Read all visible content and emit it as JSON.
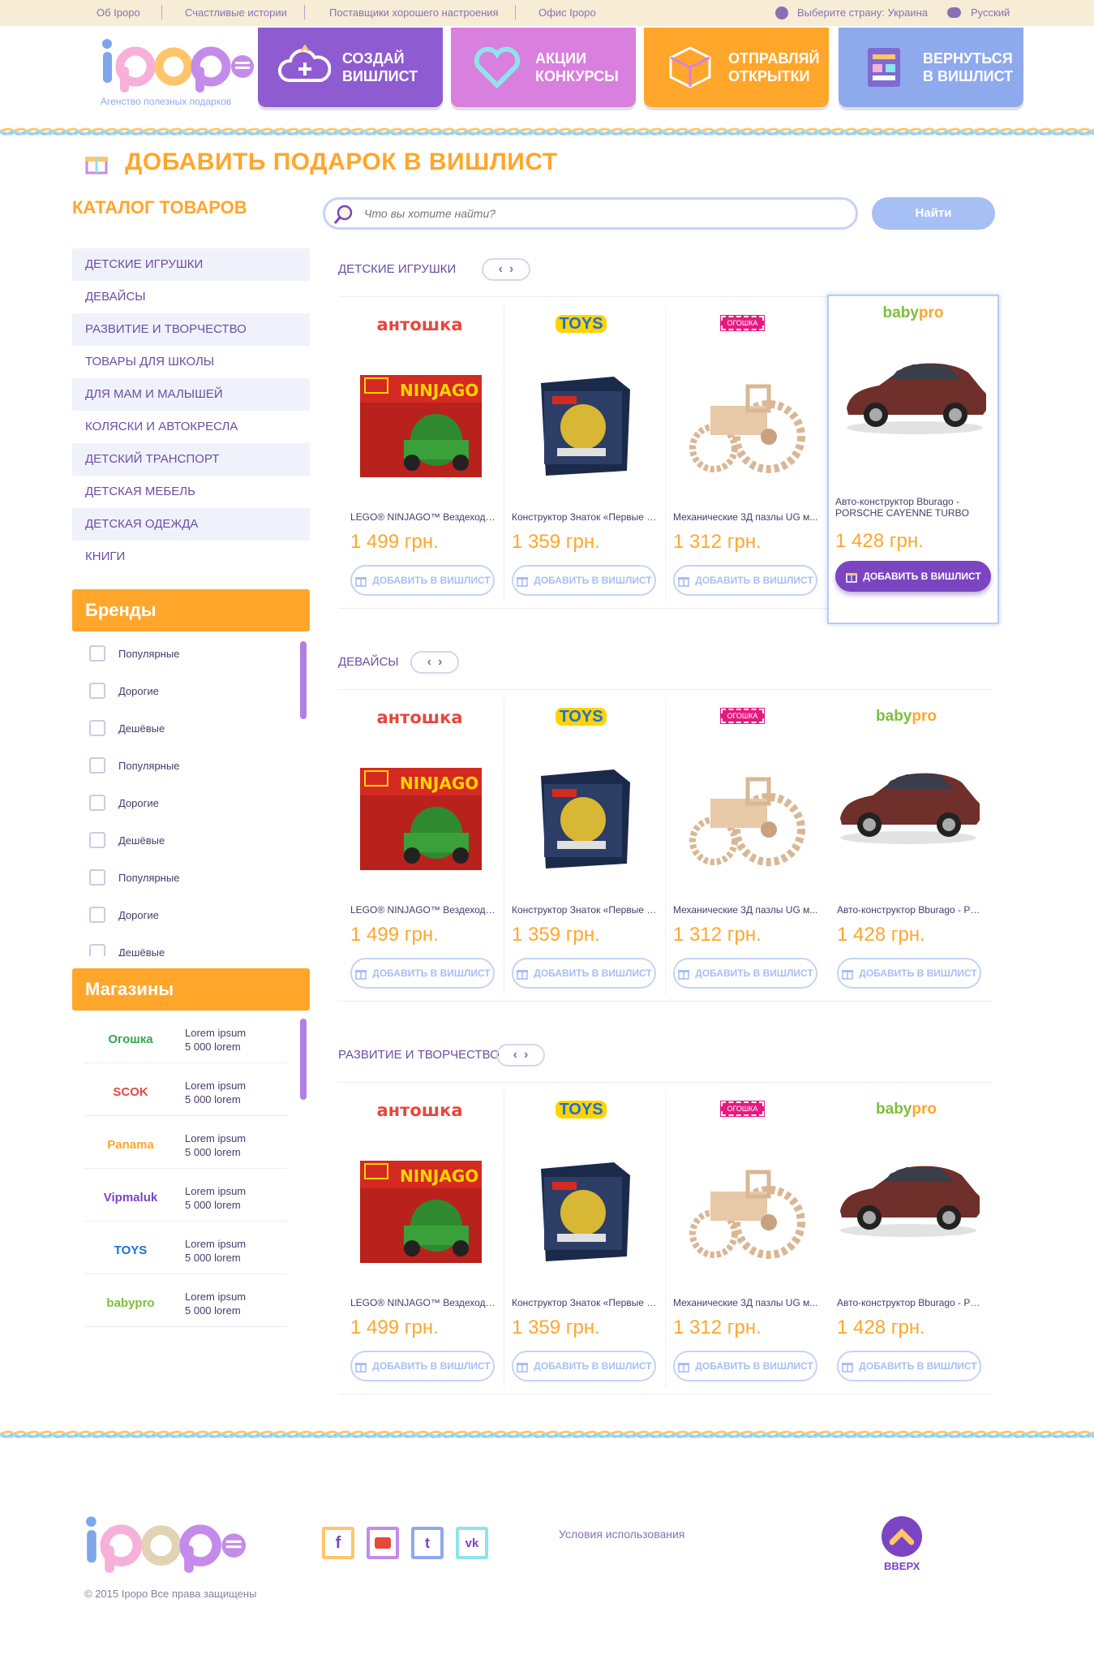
{
  "topbar": {
    "links": [
      "Об Ipopo",
      "Счастливые истории",
      "Поставщики хорошего настроения",
      "Офис Ipopo"
    ],
    "country": "Выберите страну: Украина",
    "language": "Русский"
  },
  "header": {
    "logo": "ipopo",
    "tagline": "Агенство полезных подарков",
    "tiles": [
      {
        "line1": "Создай",
        "line2": "вишлист",
        "icon": "cloud-plus-icon",
        "color": "#8f5bd0"
      },
      {
        "line1": "Акции",
        "line2": "конкурсы",
        "icon": "heart-icon",
        "color": "#d97fdd"
      },
      {
        "line1": "Отправляй",
        "line2": "открытки",
        "icon": "cube-icon",
        "color": "#ffa62b"
      },
      {
        "line1": "Вернуться",
        "line2": "в вишлист",
        "icon": "wishlist-book-icon",
        "color": "#8fa9ed"
      }
    ]
  },
  "page": {
    "title": "Добавить подарок в вишлист"
  },
  "catalog": {
    "title": "Каталог товаров",
    "items": [
      "Детские игрушки",
      "Девайсы",
      "Развитие и творчество",
      "Товары для школы",
      "Для мам и малышей",
      "Коляски и автокресла",
      "Детский транспорт",
      "Детская мебель",
      "Детская одежда",
      "Книги"
    ]
  },
  "brands": {
    "title": "Бренды",
    "items": [
      "Популярные",
      "Дорогие",
      "Дешёвые",
      "Популярные",
      "Дорогие",
      "Дешёвые",
      "Популярные",
      "Дорогие",
      "Дешёвые"
    ]
  },
  "stores": {
    "title": "Магазины",
    "items": [
      {
        "logo": "Огошка",
        "line1": "Lorem ipsum",
        "line2": "5 000 lorem"
      },
      {
        "logo": "SCOK",
        "line1": "Lorem ipsum",
        "line2": "5 000 lorem"
      },
      {
        "logo": "Panama",
        "line1": "Lorem ipsum",
        "line2": "5 000 lorem"
      },
      {
        "logo": "Vipmaluk",
        "line1": "Lorem ipsum",
        "line2": "5 000 lorem"
      },
      {
        "logo": "TOYS",
        "line1": "Lorem ipsum",
        "line2": "5 000 lorem"
      },
      {
        "logo": "babypro",
        "line1": "Lorem ipsum",
        "line2": "5 000 lorem"
      }
    ]
  },
  "search": {
    "placeholder": "Что вы хотите найти?",
    "button": "Найти"
  },
  "sections": [
    {
      "title": "Детские игрушки",
      "products": [
        {
          "brand": "антошка",
          "name": "LEGO® NINJAGO™ Вездеход дл...",
          "price": "1 499 грн.",
          "button": "Добавить в вишлист",
          "image": "lego-box"
        },
        {
          "brand": "TOYS",
          "name": "Конструктор Знаток «Первые ш...",
          "price": "1 359 грн.",
          "button": "Добавить в вишлист",
          "image": "kit-box"
        },
        {
          "brand": "ОГОШКА",
          "name": "Механические 3Д пазлы UG м...",
          "price": "1 312 грн.",
          "button": "Добавить в вишлист",
          "image": "tractor"
        },
        {
          "brand": "babypro",
          "name": "Авто-конструктор Bburago - PORSCHE CAYENNE TURBO",
          "price": "1 428 грн.",
          "button": "Добавить в вишлист",
          "image": "car",
          "highlighted": true
        }
      ]
    },
    {
      "title": "Девайсы",
      "products": [
        {
          "brand": "антошка",
          "name": "LEGO® NINJAGO™ Вездеход дл...",
          "price": "1 499 грн.",
          "button": "Добавить в вишлист",
          "image": "lego-box"
        },
        {
          "brand": "TOYS",
          "name": "Конструктор Знаток «Первые ш...",
          "price": "1 359 грн.",
          "button": "Добавить в вишлист",
          "image": "kit-box"
        },
        {
          "brand": "ОГОШКА",
          "name": "Механические 3Д пазлы UG м...",
          "price": "1 312 грн.",
          "button": "Добавить в вишлист",
          "image": "tractor"
        },
        {
          "brand": "babypro",
          "name": "Авто-конструктор Bburago - PO...",
          "price": "1 428 грн.",
          "button": "Добавить в вишлист",
          "image": "car"
        }
      ]
    },
    {
      "title": "Развитие и творчество",
      "products": [
        {
          "brand": "антошка",
          "name": "LEGO® NINJAGO™ Вездеход дл...",
          "price": "1 499 грн.",
          "button": "Добавить в вишлист",
          "image": "lego-box"
        },
        {
          "brand": "TOYS",
          "name": "Конструктор Знаток «Первые ш...",
          "price": "1 359 грн.",
          "button": "Добавить в вишлист",
          "image": "kit-box"
        },
        {
          "brand": "ОГОШКА",
          "name": "Механические 3Д пазлы UG м...",
          "price": "1 312 грн.",
          "button": "Добавить в вишлист",
          "image": "tractor"
        },
        {
          "brand": "babypro",
          "name": "Авто-конструктор Bburago - PO...",
          "price": "1 428 грн.",
          "button": "Добавить в вишлист",
          "image": "car"
        }
      ]
    }
  ],
  "footer": {
    "logo": "ipopo",
    "copyright": "© 2015 Ipopo Все права защищены",
    "terms": "Условия использования",
    "up": "Вверх",
    "social": [
      "facebook-icon",
      "youtube-icon",
      "twitter-icon",
      "vk-icon"
    ]
  },
  "colors": {
    "accent": "#ffa62b",
    "purple": "#7b45c2",
    "blue": "#a6bff5"
  }
}
